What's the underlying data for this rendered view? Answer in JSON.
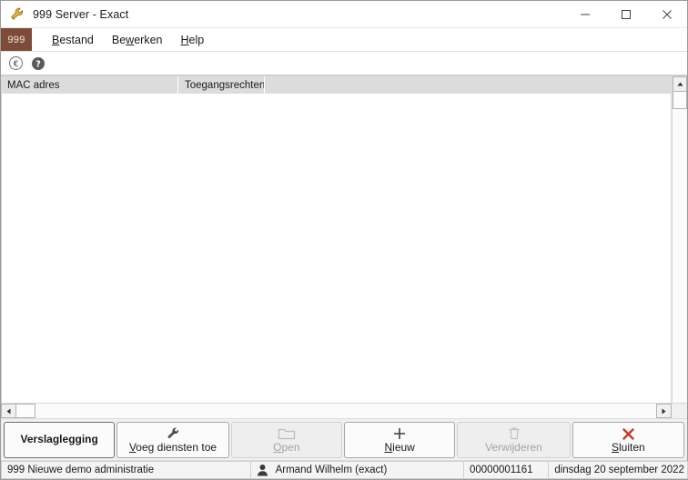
{
  "window": {
    "title": "999 Server - Exact",
    "icon": "wrench-icon",
    "minimize_label": "—",
    "maximize_label": "□",
    "close_label": "✕"
  },
  "menubar": {
    "badge": "999",
    "items": [
      {
        "label": "Bestand",
        "mnemonic": "B"
      },
      {
        "label": "Bewerken",
        "mnemonic": "w"
      },
      {
        "label": "Help",
        "mnemonic": "H"
      }
    ]
  },
  "toolbar": {
    "items": [
      {
        "name": "euro-back-icon",
        "tooltip": "€"
      },
      {
        "name": "help-icon",
        "tooltip": "?"
      }
    ]
  },
  "grid": {
    "columns": [
      {
        "label": "MAC adres"
      },
      {
        "label": "Toegangsrechten"
      }
    ],
    "rows": []
  },
  "buttonbar": {
    "buttons": [
      {
        "label": "Verslaglegging",
        "mnemonic": "",
        "icon": "",
        "state": "default"
      },
      {
        "label": "Voeg diensten toe",
        "mnemonic": "V",
        "icon": "wrench-icon",
        "state": "enabled"
      },
      {
        "label": "Open",
        "mnemonic": "O",
        "icon": "folder-icon",
        "state": "disabled"
      },
      {
        "label": "Nieuw",
        "mnemonic": "N",
        "icon": "plus-icon",
        "state": "enabled"
      },
      {
        "label": "Verwijderen",
        "mnemonic": "",
        "icon": "trash-icon",
        "state": "disabled"
      },
      {
        "label": "Sluiten",
        "mnemonic": "S",
        "icon": "close-x-icon",
        "state": "enabled"
      }
    ]
  },
  "statusbar": {
    "administration": "999 Nieuwe demo administratie",
    "user_icon": "user-icon",
    "user": "Armand Wilhelm (exact)",
    "number": "00000001161",
    "date": "dinsdag 20 september 2022"
  },
  "colors": {
    "badge_brown": "#7d4c38",
    "close_red": "#c0392b",
    "header_gray": "#dcdcdc",
    "window_bg": "#f0f0f0"
  }
}
